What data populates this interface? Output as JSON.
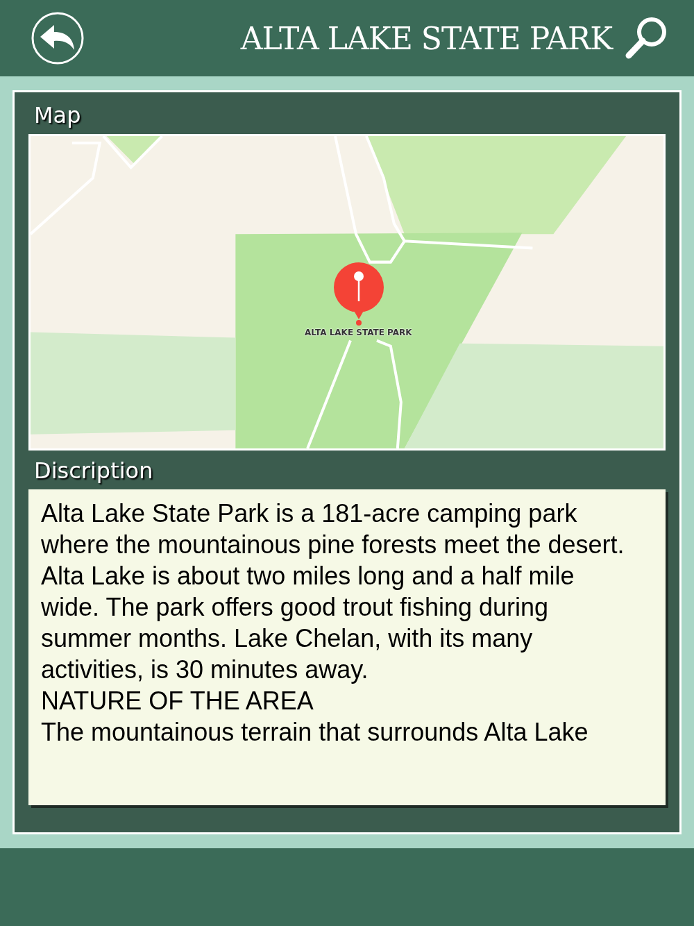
{
  "header": {
    "title": "ALTA LAKE STATE PARK"
  },
  "map_section": {
    "heading": "Map",
    "map": {
      "kind": "picture",
      "pin_label": "ALTA LAKE STATE PARK"
    }
  },
  "description_section": {
    "heading": "Discription",
    "paragraphs": [
      "Alta Lake State Park is a 181-acre camping park where the mountainous pine forests meet the desert. Alta Lake is about two miles long and a half mile wide. The park offers good trout fishing during summer months. Lake Chelan, with its many activities, is 30 minutes away.",
      "NATURE OF THE AREA",
      "The mountainous terrain that surrounds Alta Lake"
    ]
  }
}
